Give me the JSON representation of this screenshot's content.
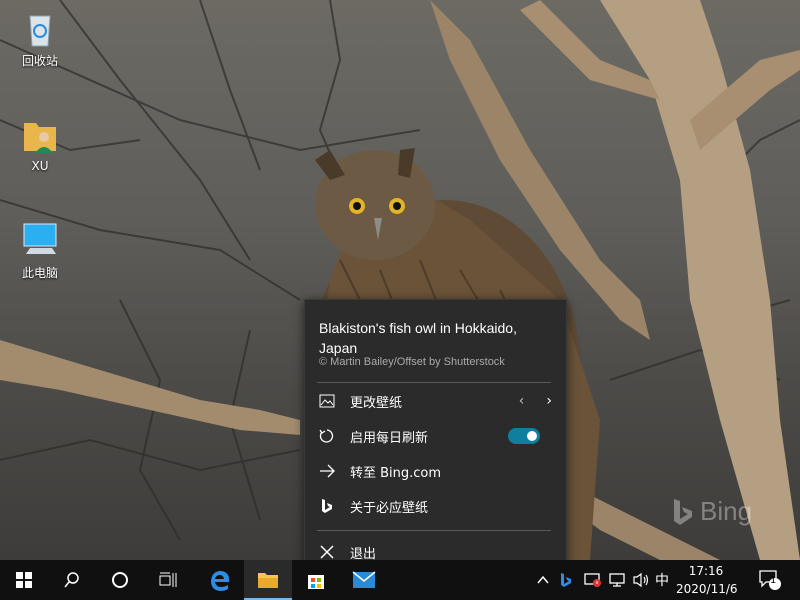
{
  "desktop": {
    "icons": [
      {
        "label": "回收站",
        "icon": "recycle-bin-icon"
      },
      {
        "label": "XU",
        "icon": "user-folder-icon"
      },
      {
        "label": "此电脑",
        "icon": "this-pc-icon"
      }
    ],
    "watermark": "Bing"
  },
  "popup": {
    "title": "Blakiston's fish owl in Hokkaido, Japan",
    "credit": "© Martin Bailey/Offset by Shutterstock",
    "menu": [
      {
        "label": "更改壁纸",
        "icon": "change-wallpaper-icon"
      },
      {
        "label": "启用每日刷新",
        "icon": "refresh-icon",
        "toggle_on": true
      },
      {
        "label": "转至 Bing.com",
        "icon": "arrow-right-icon"
      },
      {
        "label": "关于必应壁纸",
        "icon": "bing-logo-icon"
      },
      {
        "label": "退出",
        "icon": "close-icon"
      }
    ],
    "prev_glyph": "‹",
    "next_glyph": "›"
  },
  "taskbar": {
    "ime": "中",
    "time": "17:16",
    "date": "2020/11/6",
    "notification_count": "1",
    "accent": "#76b9ed"
  }
}
